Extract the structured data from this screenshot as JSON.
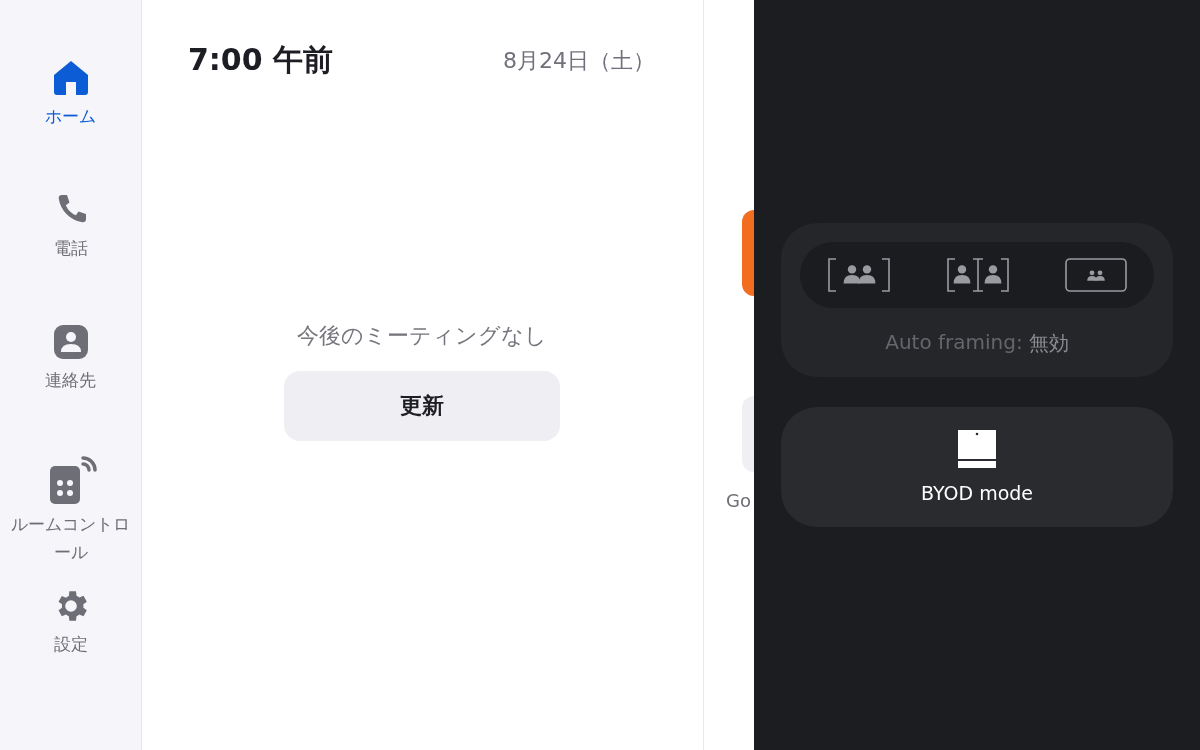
{
  "sidebar": {
    "items": [
      {
        "kind": "home",
        "label": "ホーム",
        "selected": true
      },
      {
        "kind": "phone",
        "label": "電話",
        "selected": false
      },
      {
        "kind": "contacts",
        "label": "連絡先",
        "selected": false
      },
      {
        "kind": "room",
        "label": "ルームコントロール",
        "selected": false
      },
      {
        "kind": "settings",
        "label": "設定",
        "selected": false
      }
    ]
  },
  "header": {
    "time": "7:00 午前",
    "date": "8月24日（土）"
  },
  "meetings": {
    "empty_text": "今後のミーティングなし",
    "refresh_button": "更新"
  },
  "partial_tiles": {
    "label": "Go"
  },
  "camera_panel": {
    "framing_modes": [
      {
        "kind": "group"
      },
      {
        "kind": "speaker"
      },
      {
        "kind": "off"
      }
    ],
    "status_label": "Auto framing:",
    "status_value": "無効"
  },
  "byod": {
    "label": "BYOD mode"
  }
}
